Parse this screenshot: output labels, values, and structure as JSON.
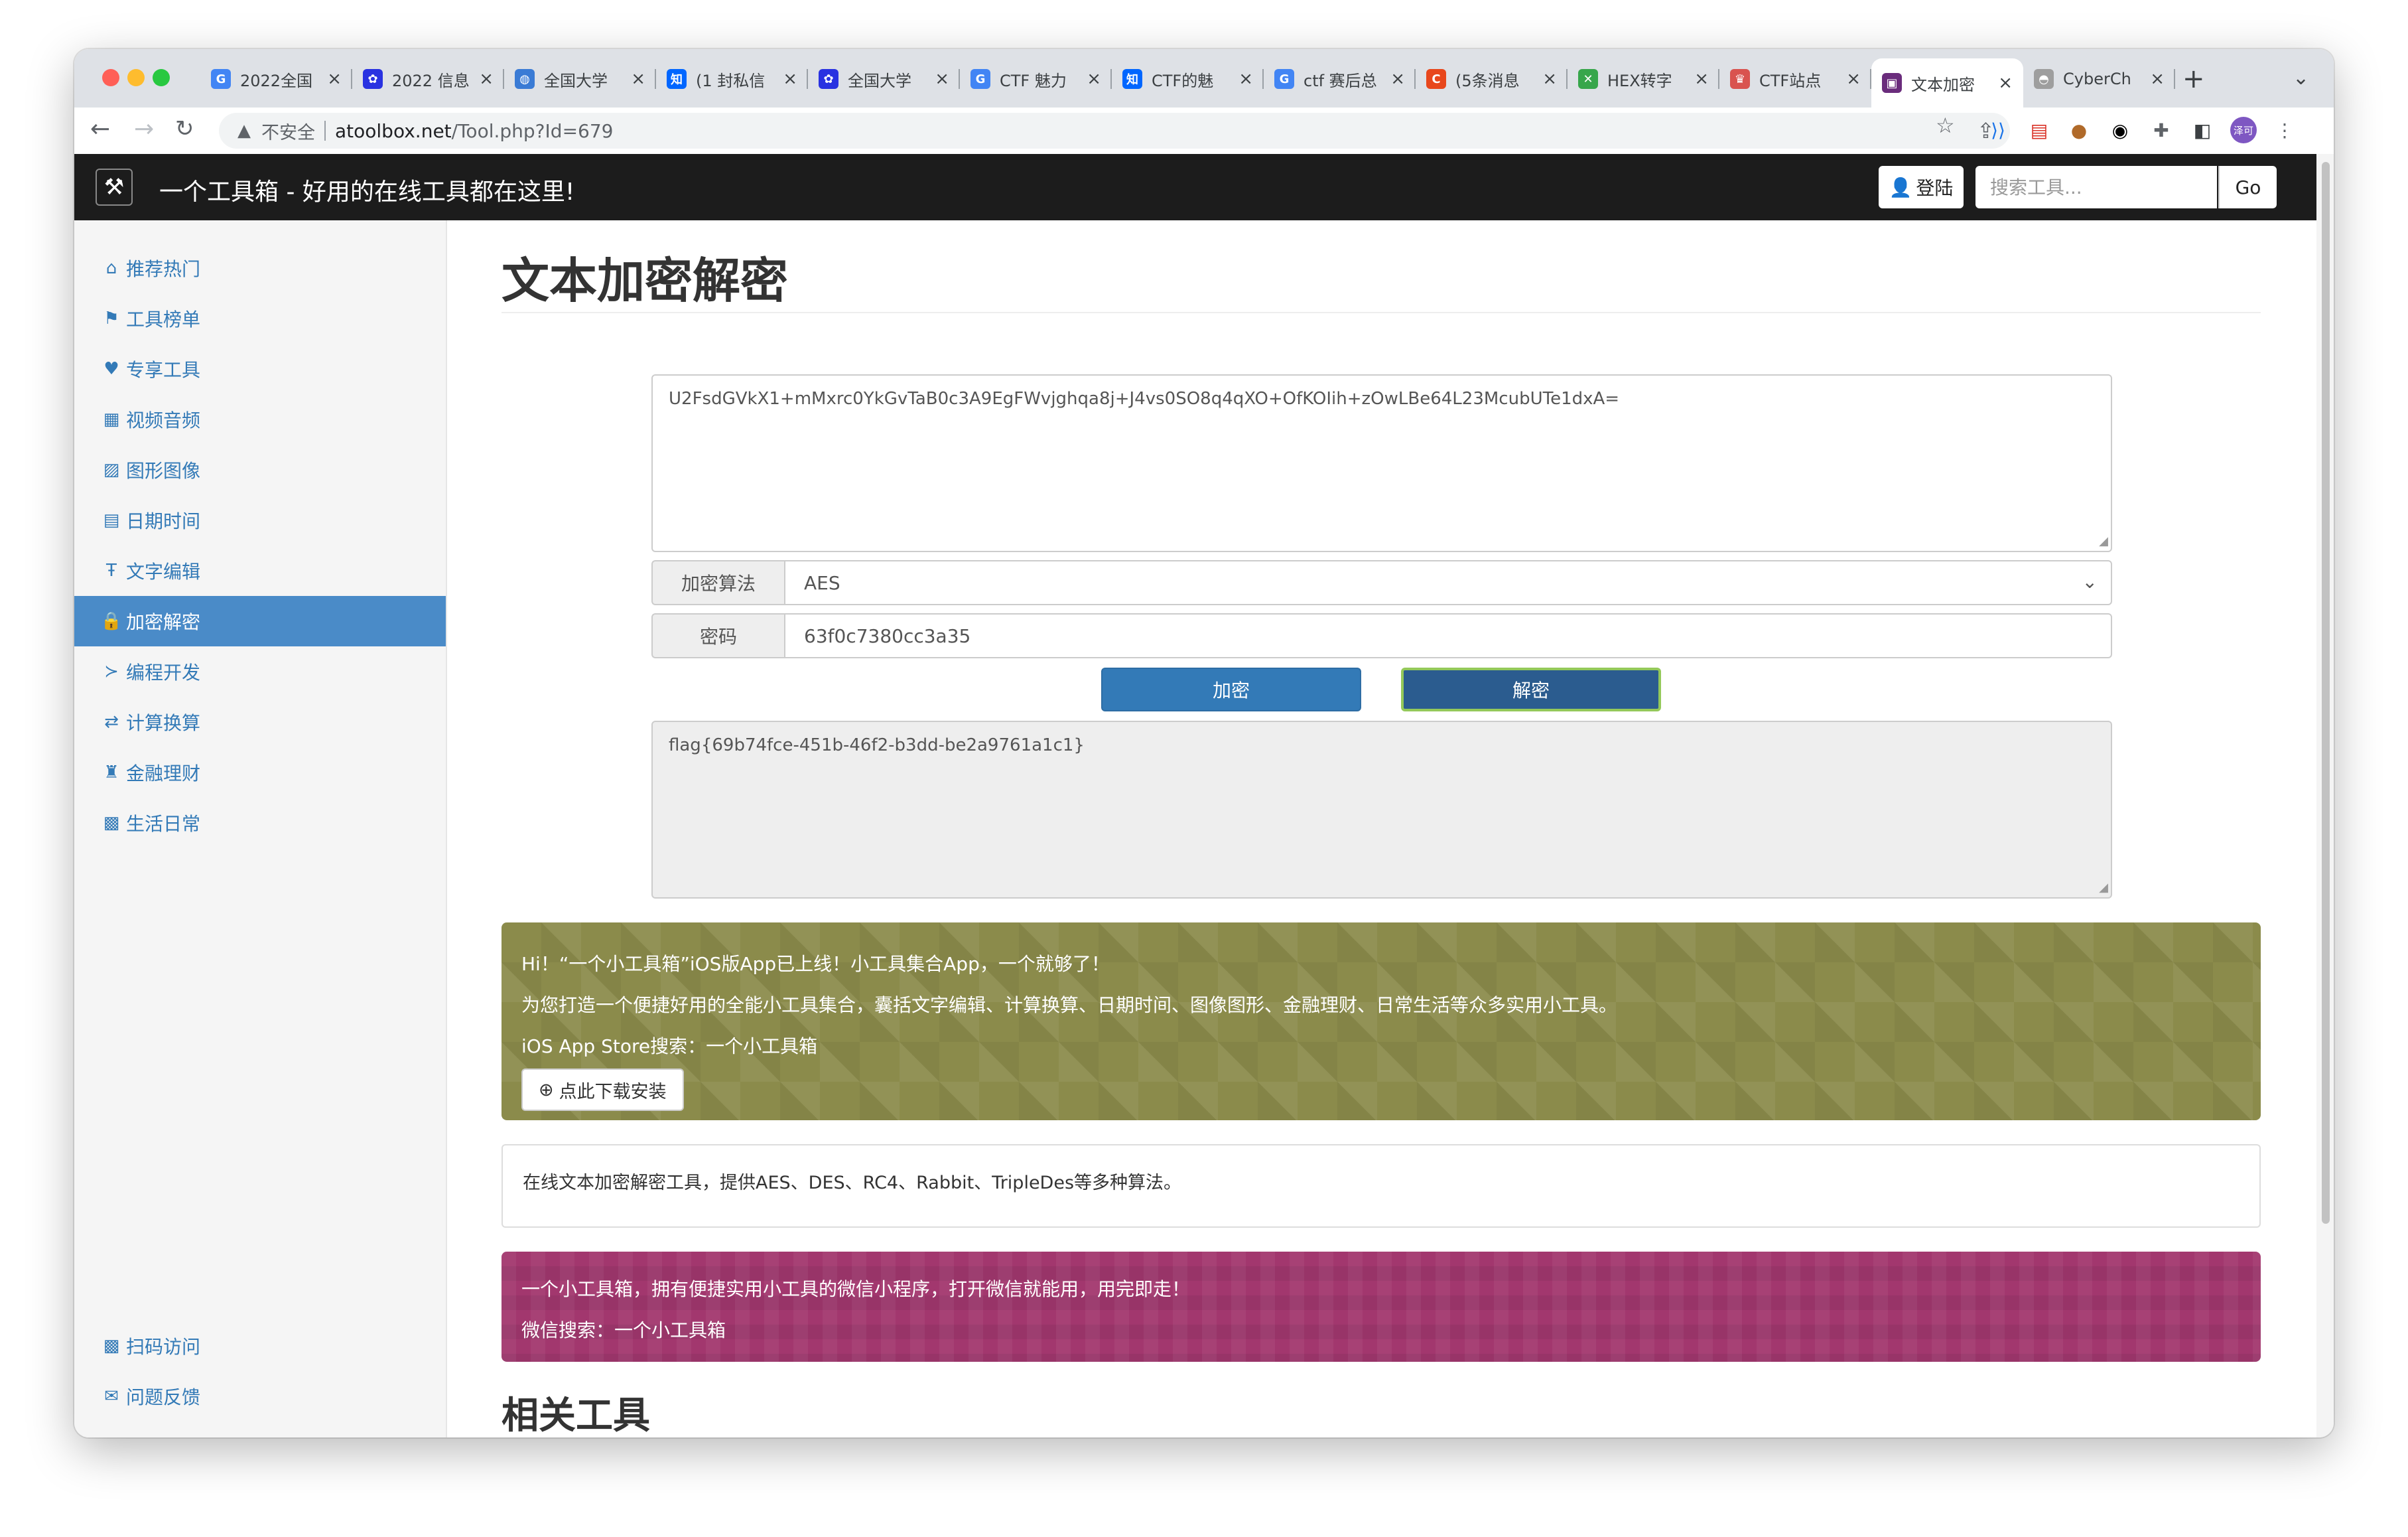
{
  "browser": {
    "traffic_colors": [
      "#ff5f57",
      "#febc2e",
      "#28c840"
    ],
    "tabs": [
      {
        "title": "2022全国",
        "icon": "google-icon",
        "color": "#4285f4",
        "glyph": "G"
      },
      {
        "title": "2022 信息",
        "icon": "baidu-icon",
        "color": "#2932e1",
        "glyph": "✿"
      },
      {
        "title": "全国大学",
        "icon": "globe-icon",
        "color": "#3a7bd5",
        "glyph": "◍"
      },
      {
        "title": "(1 封私信",
        "icon": "zhihu-icon",
        "color": "#0066ff",
        "glyph": "知"
      },
      {
        "title": "全国大学",
        "icon": "baidu-icon",
        "color": "#2932e1",
        "glyph": "✿"
      },
      {
        "title": "CTF 魅力",
        "icon": "google-icon",
        "color": "#4285f4",
        "glyph": "G"
      },
      {
        "title": "CTF的魅",
        "icon": "zhihu-icon",
        "color": "#0066ff",
        "glyph": "知"
      },
      {
        "title": "ctf 赛后总",
        "icon": "google-icon",
        "color": "#4285f4",
        "glyph": "G"
      },
      {
        "title": "(5条消息",
        "icon": "csdn-icon",
        "color": "#e8471c",
        "glyph": "C"
      },
      {
        "title": "HEX转字",
        "icon": "hex-tool-icon",
        "color": "#37a64b",
        "glyph": "✕"
      },
      {
        "title": "CTF站点",
        "icon": "ctf-site-icon",
        "color": "#d9534f",
        "glyph": "♛"
      },
      {
        "title": "文本加密",
        "icon": "toolbox-icon",
        "color": "#6a2c7c",
        "glyph": "▣",
        "active": true
      },
      {
        "title": "CyberCh",
        "icon": "cyberchef-icon",
        "color": "#9e9e9e",
        "glyph": "◓"
      }
    ],
    "not_secure": "不安全",
    "url_host": "atoolbox.net",
    "url_path": "/Tool.php?Id=679",
    "profile_label": "泽可"
  },
  "header": {
    "title": "一个工具箱 - 好用的在线工具都在这里!",
    "login": "登陆",
    "search_placeholder": "搜索工具...",
    "go": "Go"
  },
  "sidebar": {
    "items": [
      {
        "label": "推荐热门",
        "icon": "home-icon",
        "glyph": "⌂"
      },
      {
        "label": "工具榜单",
        "icon": "flag-icon",
        "glyph": "⚑"
      },
      {
        "label": "专享工具",
        "icon": "heart-icon",
        "glyph": "♥"
      },
      {
        "label": "视频音频",
        "icon": "film-icon",
        "glyph": "▦"
      },
      {
        "label": "图形图像",
        "icon": "picture-icon",
        "glyph": "▨"
      },
      {
        "label": "日期时间",
        "icon": "calendar-icon",
        "glyph": "▤"
      },
      {
        "label": "文字编辑",
        "icon": "text-size-icon",
        "glyph": "Ŧ"
      },
      {
        "label": "加密解密",
        "icon": "lock-icon",
        "glyph": "🔒",
        "active": true
      },
      {
        "label": "编程开发",
        "icon": "console-icon",
        "glyph": "≻"
      },
      {
        "label": "计算换算",
        "icon": "transfer-icon",
        "glyph": "⇄"
      },
      {
        "label": "金融理财",
        "icon": "piggy-bank-icon",
        "glyph": "♜"
      },
      {
        "label": "生活日常",
        "icon": "qrcode-icon",
        "glyph": "▩"
      }
    ],
    "bottom_items": [
      {
        "label": "扫码访问",
        "icon": "qrcode-icon",
        "glyph": "▩"
      },
      {
        "label": "问题反馈",
        "icon": "envelope-icon",
        "glyph": "✉"
      }
    ]
  },
  "main": {
    "title": "文本加密解密",
    "input_text": "U2FsdGVkX1+mMxrc0YkGvTaB0c3A9EgFWvjghqa8j+J4vs0SO8q4qXO+OfKOIih+zOwLBe64L23McubUTe1dxA=",
    "algorithm_label": "加密算法",
    "algorithm_value": "AES",
    "password_label": "密码",
    "password_value": "63f0c7380cc3a35",
    "encrypt_button": "加密",
    "decrypt_button": "解密",
    "output_text": "flag{69b74fce-451b-46f2-b3dd-be2a9761a1c1}",
    "promo": {
      "line1": "Hi！“一个小工具箱”iOS版App已上线！小工具集合App，一个就够了！",
      "line2": "为您打造一个便捷好用的全能小工具集合，囊括文字编辑、计算换算、日期时间、图像图形、金融理财、日常生活等众多实用小工具。",
      "line3": "iOS App Store搜索：一个小工具箱",
      "download": "点此下载安装"
    },
    "description": "在线文本加密解密工具，提供AES、DES、RC4、Rabbit、TripleDes等多种算法。",
    "wechat": {
      "line1": "一个小工具箱，拥有便捷实用小工具的微信小程序，打开微信就能用，用完即走！",
      "line2": "微信搜索：一个小工具箱"
    },
    "related_title": "相关工具"
  }
}
